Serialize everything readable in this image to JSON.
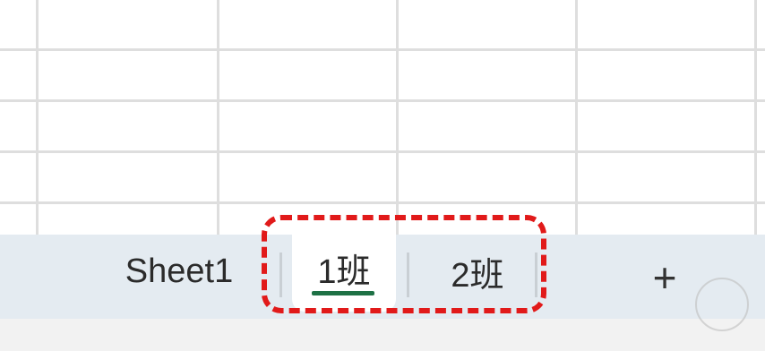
{
  "sheet_tabs": [
    {
      "label": "Sheet1",
      "active": false
    },
    {
      "label": "1班",
      "active": true
    },
    {
      "label": "2班",
      "active": false
    }
  ],
  "add_sheet_label": "+",
  "watermark_text": "",
  "colors": {
    "active_underline": "#1e7145",
    "highlight_border": "#e11a1a",
    "tabbar_background": "#e4ebf1"
  }
}
